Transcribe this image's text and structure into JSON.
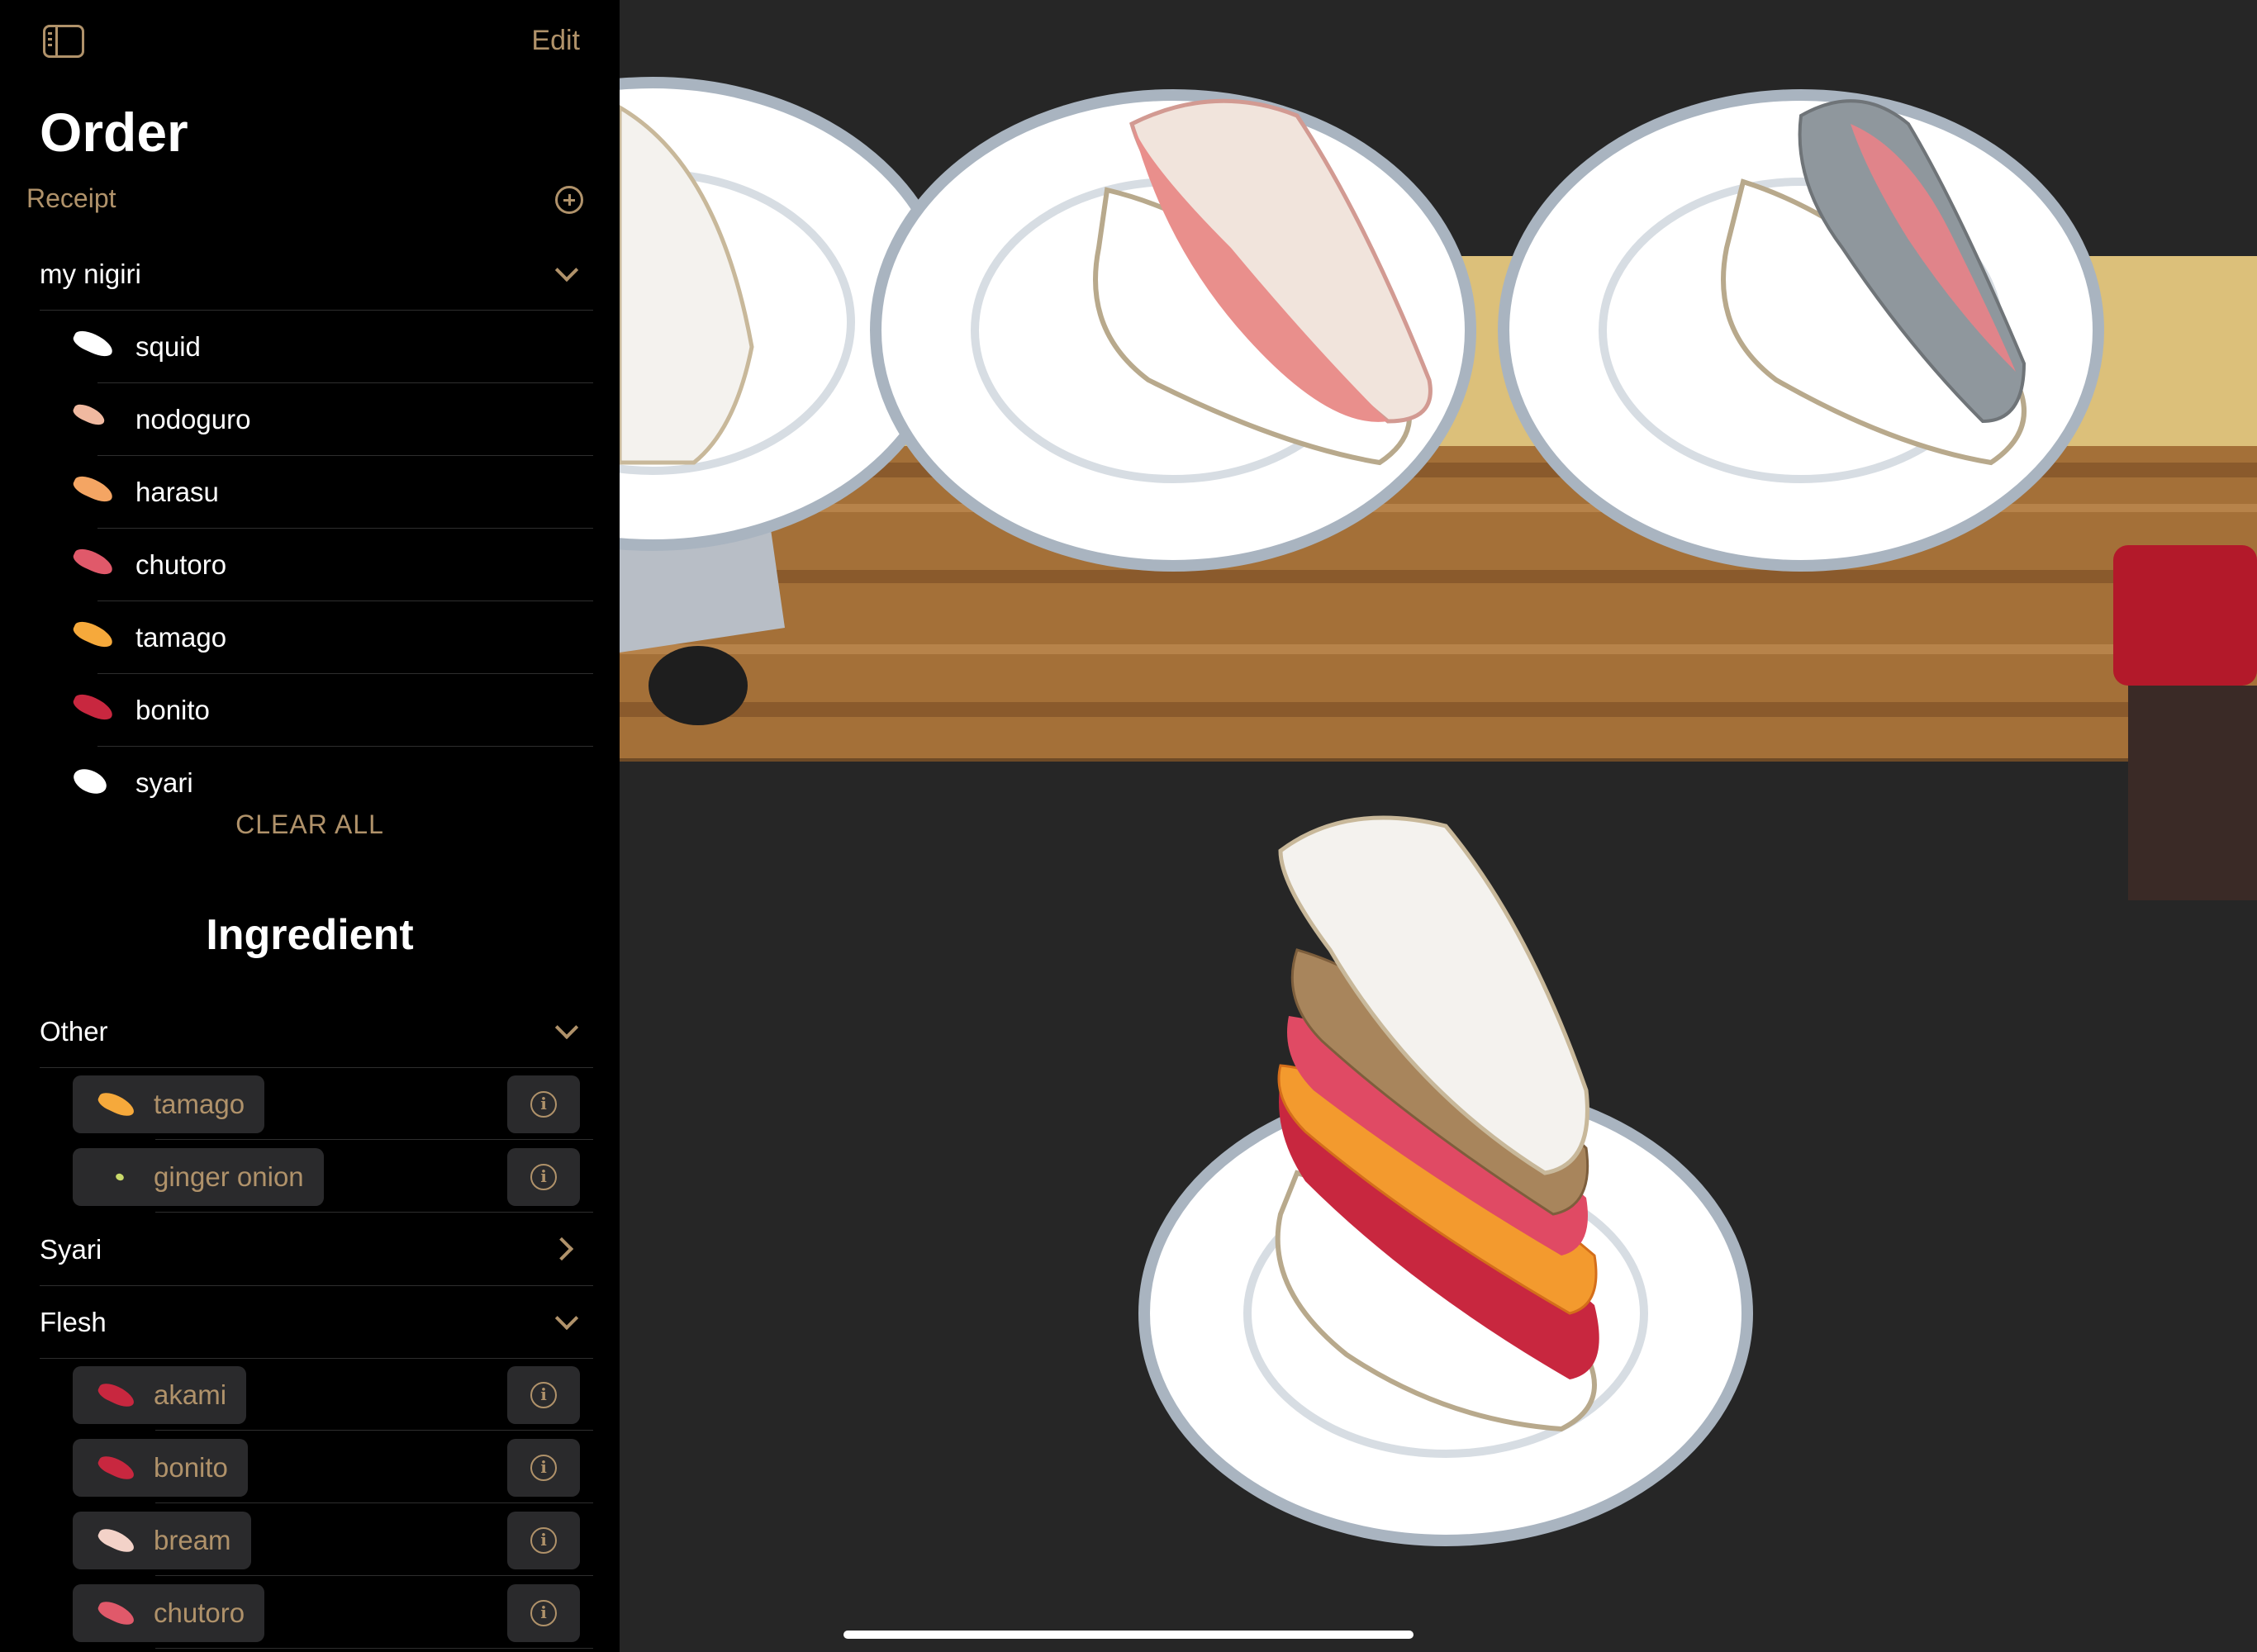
{
  "topbar": {
    "edit_label": "Edit"
  },
  "order": {
    "title": "Order",
    "receipt_label": "Receipt",
    "group_label": "my nigiri",
    "items": [
      {
        "label": "squid",
        "color": "#ffffff"
      },
      {
        "label": "nodoguro",
        "color": "#f0b9a0"
      },
      {
        "label": "harasu",
        "color": "#f4a563"
      },
      {
        "label": "chutoro",
        "color": "#e0596a"
      },
      {
        "label": "tamago",
        "color": "#f6a93b"
      },
      {
        "label": "bonito",
        "color": "#c8273f"
      },
      {
        "label": "syari",
        "color": "#ffffff"
      }
    ],
    "clear_all_label": "CLEAR ALL"
  },
  "ingredient": {
    "title": "Ingredient",
    "other_label": "Other",
    "other_items": [
      {
        "label": "tamago",
        "color": "#f6a93b"
      },
      {
        "label": "ginger onion",
        "color": "#c9d96a"
      }
    ],
    "syari_label": "Syari",
    "flesh_label": "Flesh",
    "flesh_items": [
      {
        "label": "akami",
        "color": "#c8273f"
      },
      {
        "label": "bonito",
        "color": "#c8273f"
      },
      {
        "label": "bream",
        "color": "#f3d2c8"
      },
      {
        "label": "chutoro",
        "color": "#e0596a"
      }
    ],
    "info_glyph": "i"
  },
  "colors": {
    "accent": "#b0926a",
    "sidebar_bg": "#000000",
    "canvas_bg": "#262626"
  }
}
